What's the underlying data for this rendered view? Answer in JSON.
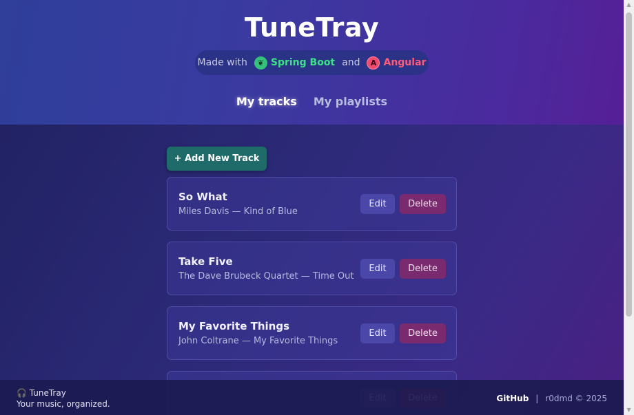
{
  "header": {
    "title": "TuneTray",
    "made_with": "Made with",
    "tech1": {
      "label": "Spring Boot",
      "icon": "spring-icon",
      "color": "#3ee08a"
    },
    "and": "and",
    "tech2": {
      "label": "Angular",
      "icon": "angular-icon",
      "color": "#ff5a7a"
    }
  },
  "nav": {
    "tracks": "My tracks",
    "playlists": "My playlists",
    "active": "tracks"
  },
  "main": {
    "add_button": "+ Add New Track",
    "edit_label": "Edit",
    "delete_label": "Delete",
    "tracks": [
      {
        "title": "So What",
        "subtitle": "Miles Davis — Kind of Blue"
      },
      {
        "title": "Take Five",
        "subtitle": "The Dave Brubeck Quartet — Time Out"
      },
      {
        "title": "My Favorite Things",
        "subtitle": "John Coltrane — My Favorite Things"
      },
      {
        "title": "",
        "subtitle": ""
      }
    ]
  },
  "footer": {
    "brand": "🎧 TuneTray",
    "tagline": "Your music, organized.",
    "github": "GitHub",
    "separator": "|",
    "copyright": "r0dmd © 2025"
  }
}
